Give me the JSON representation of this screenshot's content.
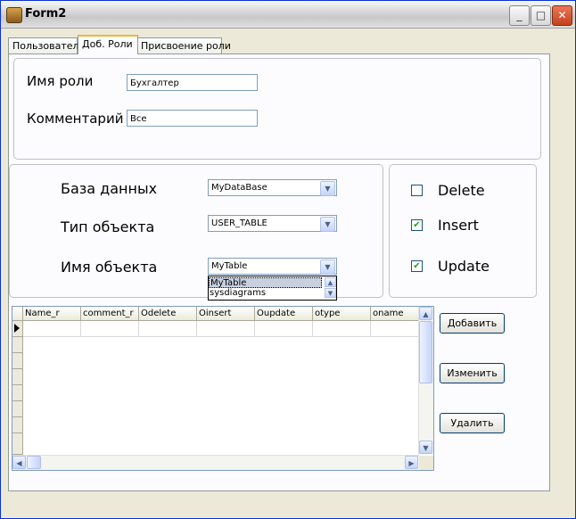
{
  "window": {
    "title": "Form2"
  },
  "tabs": [
    {
      "label": "Пользователи"
    },
    {
      "label": "Доб. Роли"
    },
    {
      "label": "Присвоение роли"
    }
  ],
  "role_form": {
    "role_name_label": "Имя роли",
    "role_name_value": "Бухгалтер",
    "comment_label": "Комментарий",
    "comment_value": "Все"
  },
  "object_form": {
    "database_label": "База данных",
    "database_value": "MyDataBase",
    "object_type_label": "Тип объекта",
    "object_type_value": "USER_TABLE",
    "object_name_label": "Имя объекта",
    "object_name_value": "MyTable",
    "object_name_options": [
      "MyTable",
      "sysdiagrams"
    ]
  },
  "permissions": {
    "delete": {
      "label": "Delete",
      "checked": false
    },
    "insert": {
      "label": "Insert",
      "checked": true
    },
    "update": {
      "label": "Update",
      "checked": true
    }
  },
  "grid": {
    "columns": [
      "Name_r",
      "comment_r",
      "Odelete",
      "Oinsert",
      "Oupdate",
      "otype",
      "oname"
    ]
  },
  "buttons": {
    "add": "Добавить",
    "edit": "Изменить",
    "delete": "Удалить"
  },
  "icons": {
    "title_icon": "app-icon",
    "minimize": "minimize-icon",
    "maximize": "maximize-icon",
    "close": "close-icon",
    "dropdown": "chevron-down-icon",
    "current_row": "row-pointer-icon"
  }
}
